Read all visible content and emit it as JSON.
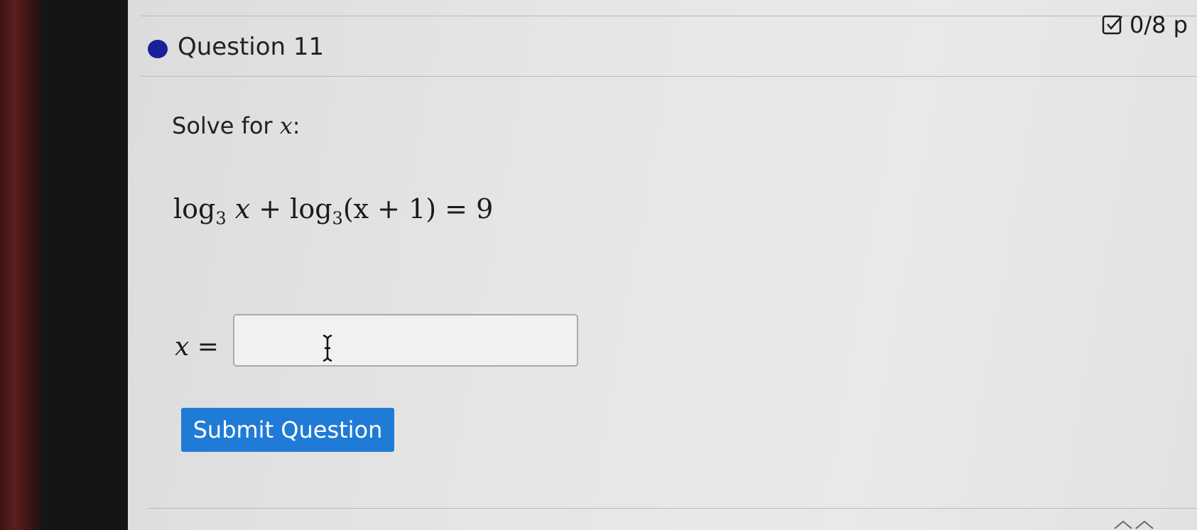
{
  "question": {
    "title": "Question 11",
    "score": "0/8 p",
    "prompt_prefix": "Solve for ",
    "prompt_var": "x",
    "prompt_suffix": ":"
  },
  "equation": {
    "log1": "log",
    "base1": "3",
    "var1": "x",
    "op1": " + ",
    "log2": "log",
    "base2": "3",
    "inner": "(x + 1)",
    "rhs": " = 9"
  },
  "answer": {
    "label_var": "x",
    "label_eq": " =",
    "value": "",
    "placeholder": ""
  },
  "submit": {
    "label": "Submit Question"
  },
  "colors": {
    "accent": "#1f7bd6",
    "indicator": "#1a1f9a"
  }
}
